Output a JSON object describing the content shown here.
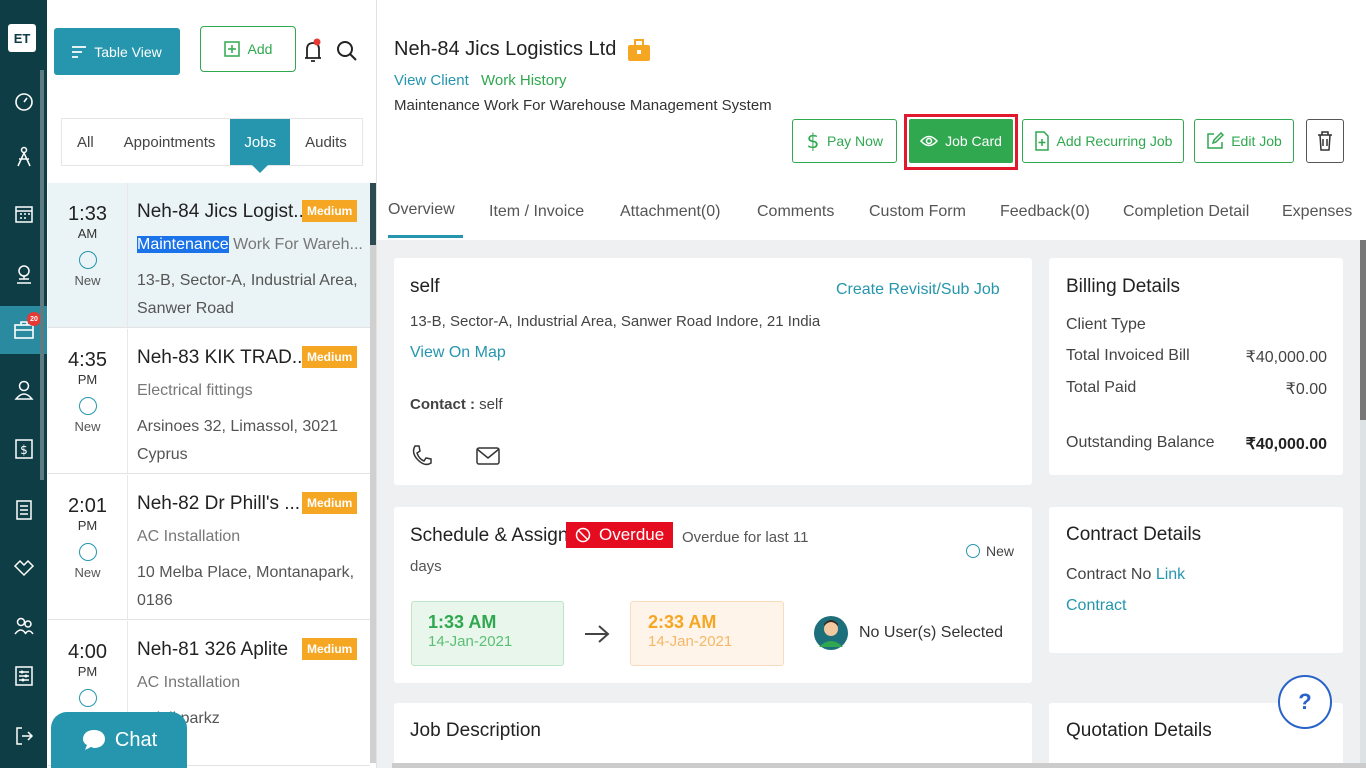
{
  "rail": {
    "logo": "ET",
    "icons": [
      "dashboard-icon",
      "dispatch-icon",
      "calendar-icon",
      "map-icon",
      "jobs-icon",
      "customer-icon",
      "invoice-icon",
      "checklist-icon",
      "handshake-icon",
      "team-icon",
      "settings-icon",
      "logout-icon"
    ],
    "badge": "20"
  },
  "toolbar": {
    "table_view": "Table View",
    "add": "Add"
  },
  "list_tabs": [
    "All",
    "Appointments",
    "Jobs",
    "Audits"
  ],
  "jobs": [
    {
      "time": "1:33",
      "ampm": "AM",
      "status": "New",
      "title": "Neh-84 Jics Logist...",
      "priority": "Medium",
      "sub_highlight": "Maintenance",
      "sub_rest": " Work For Wareh...",
      "address": "13-B, Sector-A, Industrial Area, Sanwer Road"
    },
    {
      "time": "4:35",
      "ampm": "PM",
      "status": "New",
      "title": "Neh-83 KIK TRAD...",
      "priority": "Medium",
      "sub": "Electrical fittings",
      "address": "Arsinoes 32, Limassol, 3021 Cyprus"
    },
    {
      "time": "2:01",
      "ampm": "PM",
      "status": "New",
      "title": "Neh-82 Dr Phill's ...",
      "priority": "Medium",
      "sub": "AC Installation",
      "address": "10 Melba Place, Montanapark, 0186"
    },
    {
      "time": "4:00",
      "ampm": "PM",
      "status": "",
      "title": "Neh-81 326 Aplite",
      "priority": "Medium",
      "sub": "AC Installation",
      "address": "Balaji parkz"
    }
  ],
  "chat": {
    "label": "Chat"
  },
  "job": {
    "title": "Neh-84 Jics Logistics Ltd",
    "view_client": "View Client",
    "work_history": "Work History",
    "description": "Maintenance Work For Warehouse Management System"
  },
  "actions": {
    "pay_now": "Pay Now",
    "job_card": "Job Card",
    "add_recurring": "Add Recurring Job",
    "edit_job": "Edit Job"
  },
  "detail_tabs": [
    "Overview",
    "Item / Invoice",
    "Attachment(0)",
    "Comments",
    "Custom Form",
    "Feedback(0)",
    "Completion Detail",
    "Expenses"
  ],
  "contact_card": {
    "name": "self",
    "revisit": "Create Revisit/Sub Job",
    "address": "13-B, Sector-A, Industrial Area, Sanwer Road Indore, 21 India",
    "view_map": "View On Map",
    "contact_label": "Contact :",
    "contact_value": " self"
  },
  "schedule": {
    "title": "Schedule & Assign",
    "overdue": "Overdue",
    "overdue_text_1": "Overdue for last 11",
    "overdue_text_2": "days",
    "status": "New",
    "start_time": "1:33 AM",
    "start_date": "14-Jan-2021",
    "end_time": "2:33 AM",
    "end_date": "14-Jan-2021",
    "users": "No User(s) Selected"
  },
  "job_description": {
    "title": "Job Description"
  },
  "billing": {
    "title": "Billing Details",
    "client_type": "Client Type",
    "invoiced_label": "Total Invoiced Bill",
    "invoiced_value": "₹40,000.00",
    "paid_label": "Total Paid",
    "paid_value": "₹0.00",
    "outstanding_label": "Outstanding Balance",
    "outstanding_value": "₹40,000.00"
  },
  "contract": {
    "title": "Contract Details",
    "no_label": "Contract No",
    "link": "Link",
    "contract": "Contract"
  },
  "quotation": {
    "title": "Quotation Details"
  },
  "help": "?",
  "colors": {
    "teal": "#2596ad",
    "green": "#2fa84f",
    "orange": "#f5a623",
    "red": "#e60c20",
    "rail": "#0e3d45"
  }
}
